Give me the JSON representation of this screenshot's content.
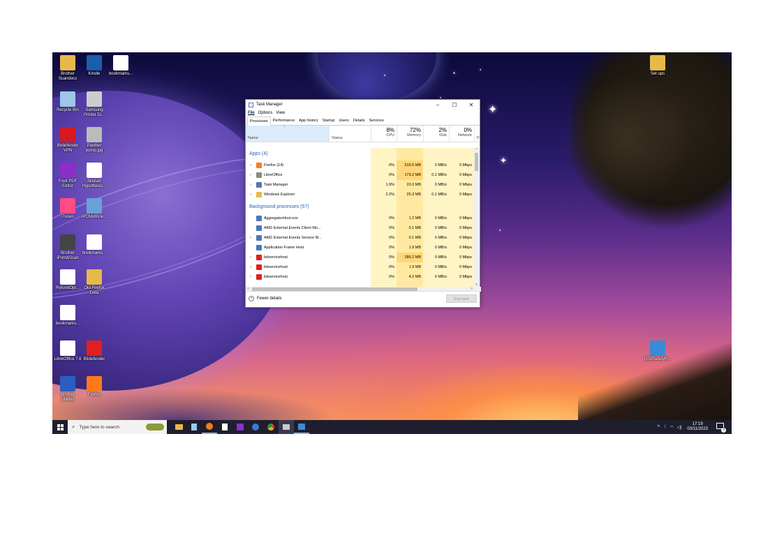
{
  "desktop": {
    "icons_left": [
      {
        "label": "Brother Scandocs",
        "icon": "folder-icon",
        "color": "#e8b84a"
      },
      {
        "label": "Kindle",
        "icon": "kindle-icon",
        "color": "#1a5fa8"
      },
      {
        "label": "bookmarks...",
        "icon": "document-icon",
        "color": "#ffffff"
      },
      {
        "label": "Recycle Bin",
        "icon": "recycle-bin-icon",
        "color": "#9fc7e8"
      },
      {
        "label": "Samsung Printer Di...",
        "icon": "printer-icon",
        "color": "#cccccc"
      },
      {
        "label": "Bitdefender VPN",
        "icon": "bitdefender-vpn-icon",
        "color": "#d8191f"
      },
      {
        "label": "Panther pump.jpg",
        "icon": "image-icon",
        "color": "#bbbbbb"
      },
      {
        "label": "Foxit PDF Editor",
        "icon": "foxit-icon",
        "color": "#8a2fc8"
      },
      {
        "label": "Silurian Hypothesis...",
        "icon": "document-icon",
        "color": "#ffffff"
      },
      {
        "label": "iTunes",
        "icon": "itunes-icon",
        "color": "#ff4c86"
      },
      {
        "label": "IPCMultiVie...",
        "icon": "computer-icon",
        "color": "#6aa0d8"
      },
      {
        "label": "Brother iPrint&Scan",
        "icon": "scanner-icon",
        "color": "#444444"
      },
      {
        "label": "bookmarks...",
        "icon": "document-icon",
        "color": "#ffffff"
      },
      {
        "label": "RefundOpt...",
        "icon": "document-icon",
        "color": "#ffffff"
      },
      {
        "label": "Old Firefox Data",
        "icon": "folder-icon",
        "color": "#e8b84a"
      },
      {
        "label": "bookmarks...",
        "icon": "document-icon",
        "color": "#ffffff"
      },
      {
        "label": "LibreOffice 7.6",
        "icon": "libreoffice-icon",
        "color": "#ffffff"
      },
      {
        "label": "Bitdefender",
        "icon": "bitdefender-icon",
        "color": "#e0201f"
      },
      {
        "label": "Brother Utilities",
        "icon": "brother-utilities-icon",
        "color": "#2a5fc0"
      },
      {
        "label": "Firefox",
        "icon": "firefox-icon",
        "color": "#ff7a1a"
      }
    ],
    "icons_right": [
      {
        "label": "Set ups",
        "icon": "folder-icon",
        "color": "#e8b84a"
      },
      {
        "label": "USBSafelyR...",
        "icon": "usb-icon",
        "color": "#3a8ad8"
      }
    ]
  },
  "task_manager": {
    "title": "Task Manager",
    "menu": [
      "File",
      "Options",
      "View"
    ],
    "tabs": [
      "Processes",
      "Performance",
      "App history",
      "Startup",
      "Users",
      "Details",
      "Services"
    ],
    "active_tab": "Processes",
    "columns": {
      "name": "Name",
      "status": "Status",
      "cpu": {
        "pct": "8%",
        "label": "CPU"
      },
      "memory": {
        "pct": "72%",
        "label": "Memory"
      },
      "disk": {
        "pct": "2%",
        "label": "Disk"
      },
      "network": {
        "pct": "0%",
        "label": "Network"
      },
      "extra": "P"
    },
    "apps_header": "Apps (4)",
    "apps": [
      {
        "name": "Firefox (14)",
        "cpu": "0%",
        "mem": "516.5 MB",
        "disk": "0 MB/s",
        "net": "0 Mbps",
        "icon": "firefox-icon",
        "color": "#ff7a1a"
      },
      {
        "name": "LibreOffice",
        "cpu": "0%",
        "mem": "179.2 MB",
        "disk": "0.1 MB/s",
        "net": "0 Mbps",
        "icon": "libreoffice-icon",
        "color": "#8a8a8a"
      },
      {
        "name": "Task Manager",
        "cpu": "1.9%",
        "mem": "20.3 MB",
        "disk": "0 MB/s",
        "net": "0 Mbps",
        "icon": "task-manager-icon",
        "color": "#5577aa"
      },
      {
        "name": "Windows Explorer",
        "cpu": "2.2%",
        "mem": "25.3 MB",
        "disk": "0.1 MB/s",
        "net": "0 Mbps",
        "icon": "folder-icon",
        "color": "#e8b84a"
      }
    ],
    "bg_header": "Background processes (57)",
    "background": [
      {
        "name": "AggregatorHost.exe",
        "cpu": "0%",
        "mem": "1.2 MB",
        "disk": "0 MB/s",
        "net": "0 Mbps",
        "expandable": false,
        "icon": "process-icon",
        "color": "#4a78b8"
      },
      {
        "name": "AMD External Events Client Mo...",
        "cpu": "0%",
        "mem": "0.1 MB",
        "disk": "0 MB/s",
        "net": "0 Mbps",
        "expandable": false,
        "icon": "process-icon",
        "color": "#4a78b8"
      },
      {
        "name": "AMD External Events Service M...",
        "cpu": "0%",
        "mem": "0.1 MB",
        "disk": "0 MB/s",
        "net": "0 Mbps",
        "expandable": true,
        "icon": "process-icon",
        "color": "#4a78b8"
      },
      {
        "name": "Application Frame Host",
        "cpu": "0%",
        "mem": "1.9 MB",
        "disk": "0 MB/s",
        "net": "0 Mbps",
        "expandable": false,
        "icon": "process-icon",
        "color": "#4a78b8"
      },
      {
        "name": "bdservicehost",
        "cpu": "0%",
        "mem": "286.2 MB",
        "disk": "0 MB/s",
        "net": "0 Mbps",
        "expandable": true,
        "icon": "bitdefender-icon",
        "color": "#e0201f"
      },
      {
        "name": "bdservicehost",
        "cpu": "0%",
        "mem": "1.9 MB",
        "disk": "0 MB/s",
        "net": "0 Mbps",
        "expandable": true,
        "icon": "bitdefender-icon",
        "color": "#e0201f"
      },
      {
        "name": "bdservicehost",
        "cpu": "0%",
        "mem": "4.2 MB",
        "disk": "0 MB/s",
        "net": "0 Mbps",
        "expandable": true,
        "icon": "bitdefender-icon",
        "color": "#e0201f"
      }
    ],
    "fewer_details": "Fewer details",
    "end_task": "End task"
  },
  "taskbar": {
    "search_placeholder": "Type here to search",
    "pinned": [
      "start-icon",
      "file-explorer-icon",
      "notepad-icon",
      "firefox-icon",
      "document-icon",
      "foxit-icon",
      "browser-icon",
      "chrome-icon",
      "printer-icon",
      "task-manager-icon"
    ],
    "time": "17:19",
    "date": "03/11/2023",
    "notification_count": "3"
  }
}
